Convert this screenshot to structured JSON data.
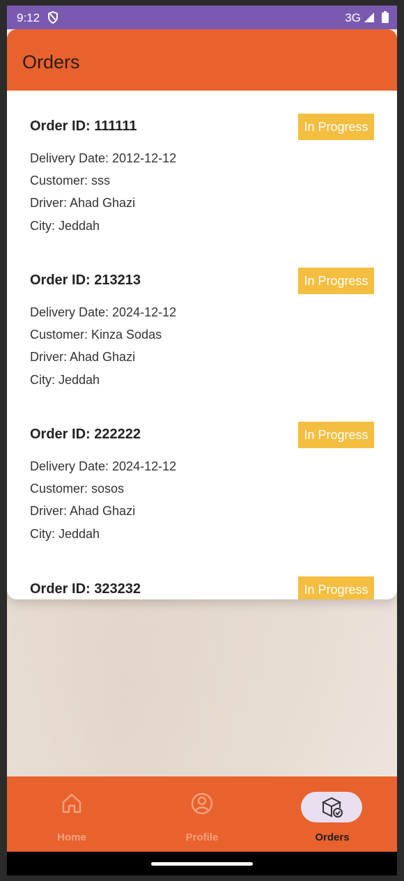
{
  "status": {
    "time": "9:12",
    "network": "3G"
  },
  "header": {
    "title": "Orders"
  },
  "orders": [
    {
      "id": "Order ID: 111111",
      "status": "In Progress",
      "delivery": "Delivery Date: 2012-12-12",
      "customer": "Customer: sss",
      "driver": "Driver: Ahad Ghazi",
      "city": "City: Jeddah"
    },
    {
      "id": "Order ID: 213213",
      "status": "In Progress",
      "delivery": "Delivery Date: 2024-12-12",
      "customer": "Customer: Kinza Sodas",
      "driver": "Driver: Ahad Ghazi",
      "city": "City: Jeddah"
    },
    {
      "id": "Order ID: 222222",
      "status": "In Progress",
      "delivery": "Delivery Date: 2024-12-12",
      "customer": "Customer: sosos",
      "driver": "Driver: Ahad Ghazi",
      "city": "City: Jeddah"
    },
    {
      "id": "Order ID: 323232",
      "status": "In Progress"
    }
  ],
  "nav": {
    "home": {
      "label": "Home",
      "icon": "home-icon"
    },
    "profile": {
      "label": "Profile",
      "icon": "profile-icon"
    },
    "orders": {
      "label": "Orders",
      "icon": "package-icon"
    }
  },
  "colors": {
    "primary": "#e8622e",
    "status_bar": "#7a5ab0",
    "badge": "#f4be40",
    "active_pill": "#eadff0",
    "inactive_nav": "#f7a27c",
    "active_nav": "#1f1f1f"
  }
}
